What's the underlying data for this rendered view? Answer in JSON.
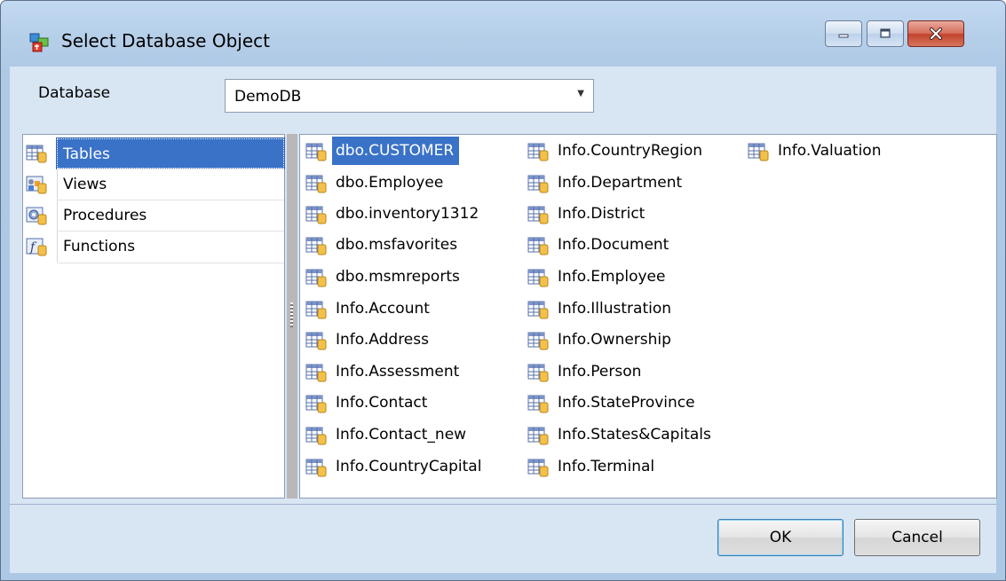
{
  "window": {
    "title": "Select Database Object"
  },
  "database": {
    "label": "Database",
    "value": "DemoDB"
  },
  "categories": [
    {
      "label": "Tables",
      "icon": "table-icon",
      "selected": true
    },
    {
      "label": "Views",
      "icon": "view-icon",
      "selected": false
    },
    {
      "label": "Procedures",
      "icon": "procedure-icon",
      "selected": false
    },
    {
      "label": "Functions",
      "icon": "function-icon",
      "selected": false
    }
  ],
  "objects": {
    "col1": [
      "dbo.CUSTOMER",
      "dbo.Employee",
      "dbo.inventory1312",
      "dbo.msfavorites",
      "dbo.msmreports",
      "Info.Account",
      "Info.Address",
      "Info.Assessment",
      "Info.Contact",
      "Info.Contact_new",
      "Info.CountryCapital"
    ],
    "col2": [
      "Info.CountryRegion",
      "Info.Department",
      "Info.District",
      "Info.Document",
      "Info.Employee",
      "Info.Illustration",
      "Info.Ownership",
      "Info.Person",
      "Info.StateProvince",
      "Info.States&Capitals",
      "Info.Terminal"
    ],
    "col3": [
      "Info.Valuation"
    ],
    "selected": "dbo.CUSTOMER"
  },
  "buttons": {
    "ok": "OK",
    "cancel": "Cancel"
  },
  "colors": {
    "selection": "#3a72c8",
    "dialog_bg": "#d8e5f3",
    "titlebar": "#b6cfe9",
    "close_button": "#c2422c"
  }
}
